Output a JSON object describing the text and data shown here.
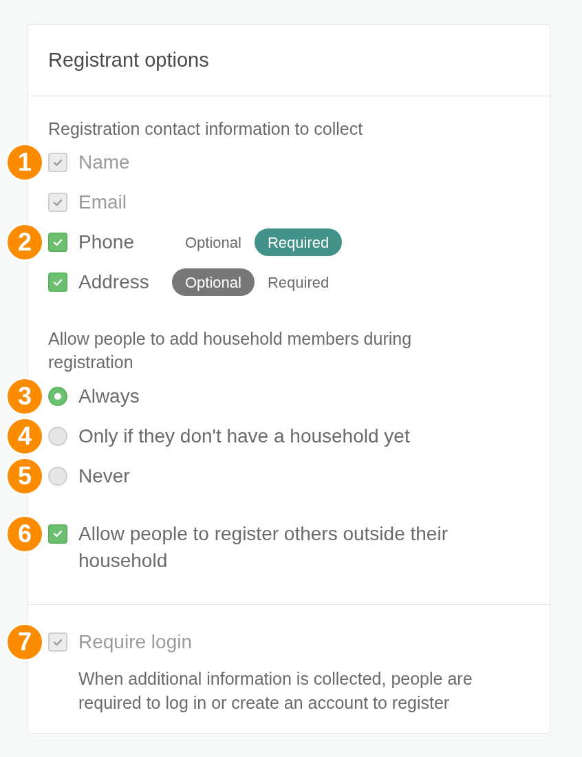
{
  "title": "Registrant options",
  "contact": {
    "label": "Registration contact information to collect",
    "fields": [
      {
        "label": "Name",
        "checked": true,
        "disabled": true,
        "callout": "1"
      },
      {
        "label": "Email",
        "checked": true,
        "disabled": true
      },
      {
        "label": "Phone",
        "checked": true,
        "disabled": false,
        "callout": "2",
        "choices": [
          {
            "label": "Optional",
            "selected": false
          },
          {
            "label": "Required",
            "selected": true
          }
        ]
      },
      {
        "label": "Address",
        "checked": true,
        "disabled": false,
        "choices": [
          {
            "label": "Optional",
            "selected": true
          },
          {
            "label": "Required",
            "selected": false
          }
        ]
      }
    ]
  },
  "household": {
    "label": "Allow people to add household members during registration",
    "options": [
      {
        "label": "Always",
        "selected": true,
        "callout": "3"
      },
      {
        "label": "Only if they don't have a household yet",
        "selected": false,
        "callout": "4"
      },
      {
        "label": "Never",
        "selected": false,
        "callout": "5"
      }
    ]
  },
  "others": {
    "label": "Allow people to register others outside their household",
    "checked": true,
    "disabled": false,
    "callout": "6"
  },
  "login": {
    "label": "Require login",
    "checked": true,
    "disabled": true,
    "callout": "7",
    "description": "When additional information is collected, people are required to log in or create an account to register"
  }
}
